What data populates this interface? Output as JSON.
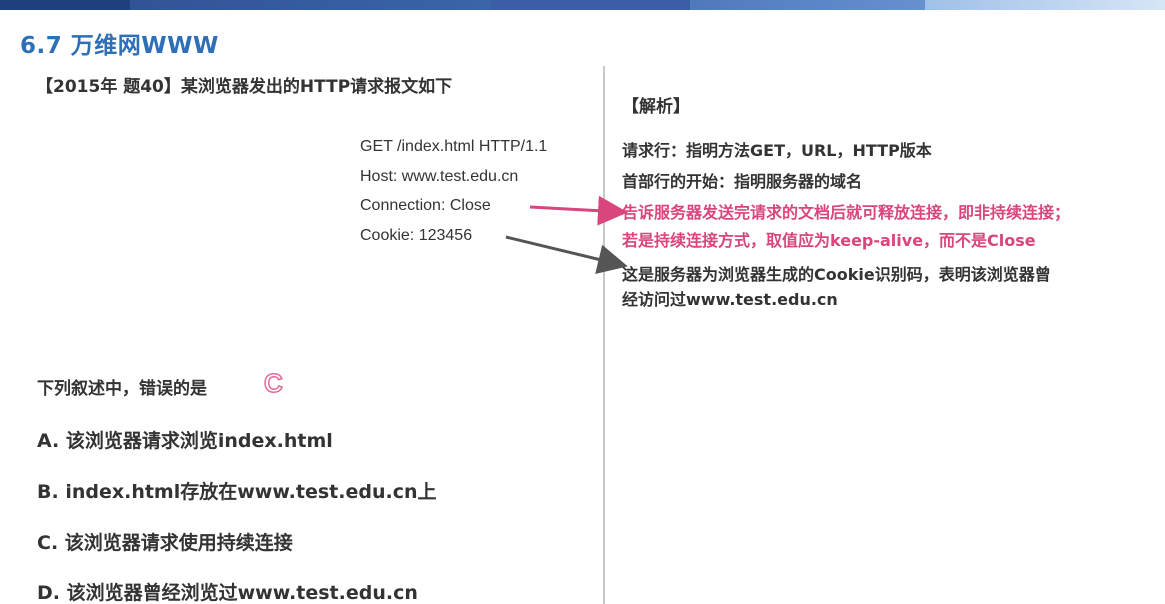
{
  "section_title": "6.7 万维网WWW",
  "question": {
    "head": "【2015年 题40】某浏览器发出的HTTP请求报文如下",
    "http_request": [
      "GET /index.html HTTP/1.1",
      "Host: www.test.edu.cn",
      "Connection: Close",
      "Cookie: 123456"
    ],
    "prompt": "下列叙述中，错误的是",
    "answer": "C",
    "options": [
      "A. 该浏览器请求浏览index.html",
      "B. index.html存放在www.test.edu.cn上",
      "C. 该浏览器请求使用持续连接",
      "D. 该浏览器曾经浏览过www.test.edu.cn"
    ]
  },
  "analysis": {
    "title": "【解析】",
    "lines": [
      "请求行：指明方法GET，URL，HTTP版本",
      "首部行的开始：指明服务器的域名",
      "告诉服务器发送完请求的文档后就可释放连接，即非持续连接；",
      "若是持续连接方式，取值应为keep-alive，而不是Close",
      "这是服务器为浏览器生成的Cookie识别码，表明该浏览器曾",
      "经访问过www.test.edu.cn"
    ]
  },
  "colors": {
    "title": "#2e6fb8",
    "highlight": "#d9457d",
    "text": "#333333"
  }
}
